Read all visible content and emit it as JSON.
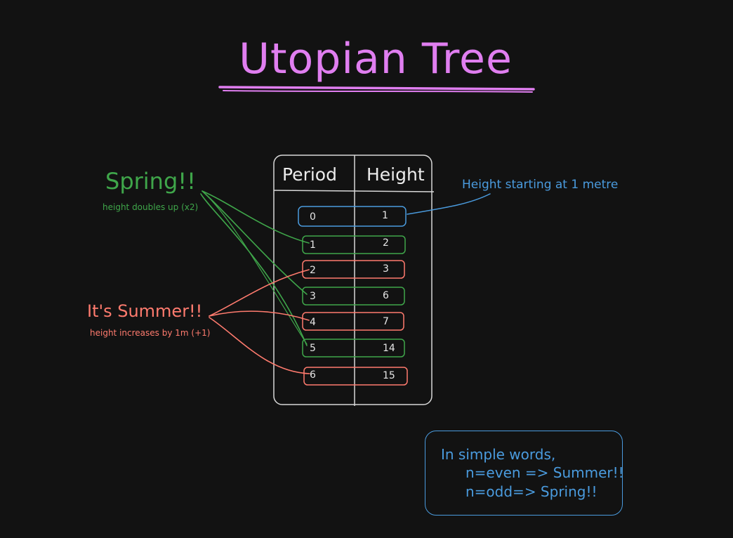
{
  "title": "Utopian Tree",
  "spring": {
    "label": "Spring!!",
    "note": "height doubles up (x2)"
  },
  "summer": {
    "label": "It's Summer!!",
    "note": "height increases by 1m (+1)"
  },
  "start_note": "Height starting at 1 metre",
  "table": {
    "headers": [
      "Period",
      "Height"
    ],
    "rows": [
      {
        "period": "0",
        "height": "1"
      },
      {
        "period": "1",
        "height": "2"
      },
      {
        "period": "2",
        "height": "3"
      },
      {
        "period": "3",
        "height": "6"
      },
      {
        "period": "4",
        "height": "7"
      },
      {
        "period": "5",
        "height": "14"
      },
      {
        "period": "6",
        "height": "15"
      }
    ]
  },
  "summary": {
    "line1": "In simple words,",
    "line2": "n=even => Summer!!",
    "line3": "n=odd=> Spring!!"
  },
  "colors": {
    "title": "#e07ef0",
    "spring": "#3fa64a",
    "summer": "#ff7b6e",
    "start": "#4a9bde",
    "table": "#d8d8d8"
  }
}
